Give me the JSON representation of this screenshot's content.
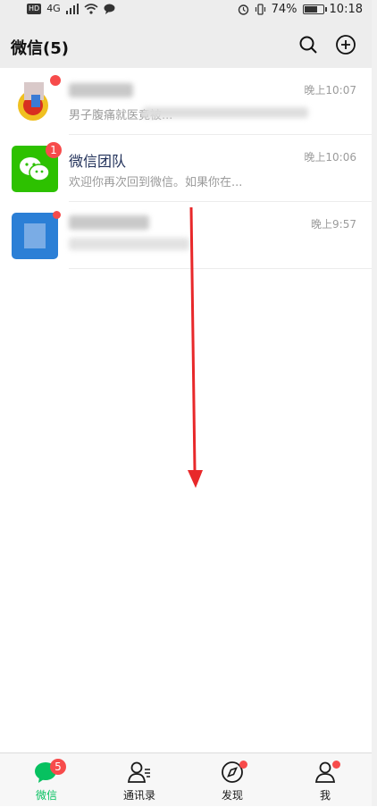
{
  "status_bar": {
    "hd": "HD",
    "network": "4G",
    "battery": "74%",
    "battery_level": 0.74,
    "time": "10:18"
  },
  "header": {
    "title": "微信(5)",
    "icons": [
      "search-icon",
      "add-circle-icon"
    ]
  },
  "chats": [
    {
      "name": "",
      "preview": "男子腹痛就医竟被...",
      "time": "晚上10:07",
      "avatar_icon": "news-app-logo"
    },
    {
      "name": "微信团队",
      "preview": "欢迎你再次回到微信。如果你在...",
      "time": "晚上10:06",
      "badge": "1",
      "avatar_icon": "wechat-logo"
    },
    {
      "name": "",
      "preview": "",
      "time": "晚上9:57",
      "avatar_icon": "blue-avatar"
    }
  ],
  "tabs": [
    {
      "label": "微信",
      "badge": "5",
      "icon": "chat-bubble-icon",
      "active": true
    },
    {
      "label": "通讯录",
      "icon": "contacts-icon"
    },
    {
      "label": "发现",
      "icon": "compass-icon"
    },
    {
      "label": "我",
      "icon": "person-icon"
    }
  ],
  "colors": {
    "accent": "#07c160",
    "badge": "#f74b4b",
    "arrow": "#e8282a"
  }
}
